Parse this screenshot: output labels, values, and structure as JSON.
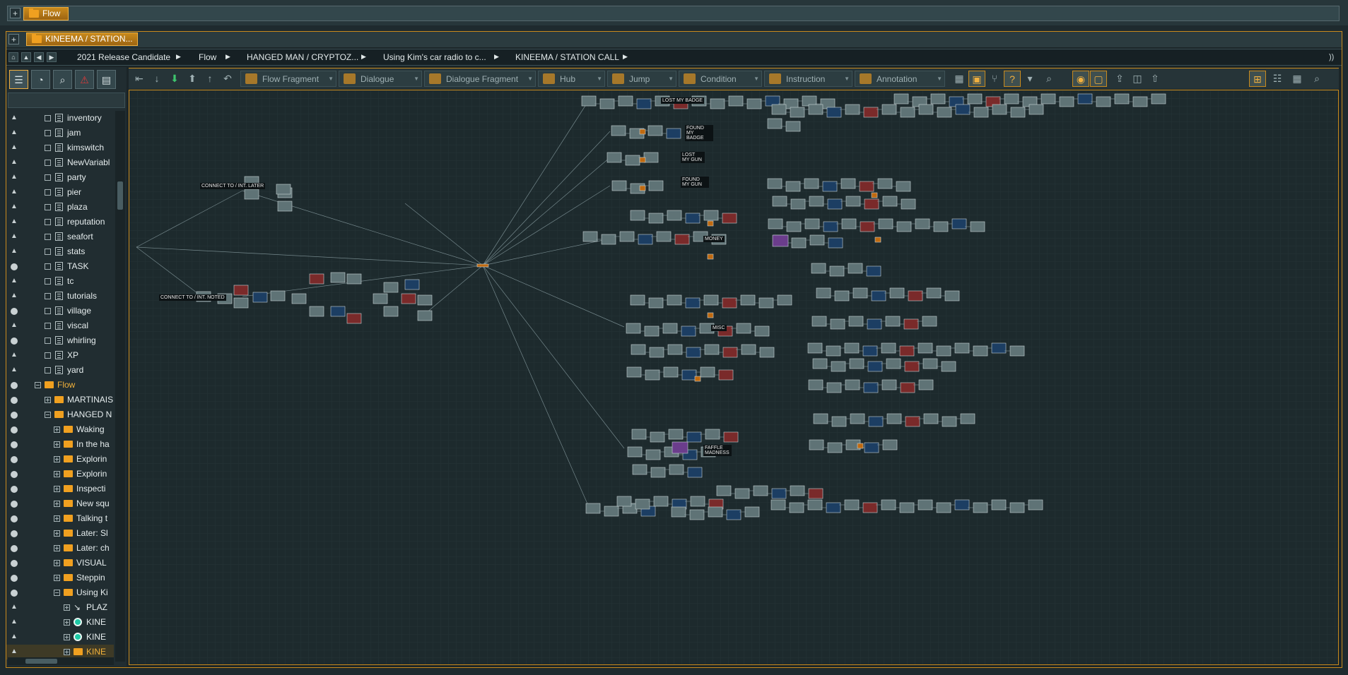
{
  "window": {
    "top_tab_label": "Flow",
    "doc_tab_label": "KINEEMA / STATION..."
  },
  "breadcrumbs": [
    "2021 Release Candidate",
    "Flow",
    "HANGED MAN / CRYPTOZ...",
    "Using Kim's car radio to c...",
    "KINEEMA / STATION CALL"
  ],
  "toolbar": {
    "buttons": [
      "Flow Fragment",
      "Dialogue",
      "Dialogue Fragment",
      "Hub",
      "Jump",
      "Condition",
      "Instruction",
      "Annotation"
    ]
  },
  "tree": {
    "variables": [
      "inventory",
      "jam",
      "kimswitch",
      "NewVariabl",
      "party",
      "pier",
      "plaza",
      "reputation",
      "seafort",
      "stats",
      "TASK",
      "tc",
      "tutorials",
      "village",
      "viscal",
      "whirling",
      "XP",
      "yard"
    ],
    "flow_label": "Flow",
    "flow_children": [
      "MARTINAIS",
      "HANGED N"
    ],
    "hanged_children": [
      "Waking",
      "In the ha",
      "Explorin",
      "Explorin",
      "Inspecti",
      "New squ",
      "Talking t",
      "Later: Sl",
      "Later: ch",
      "VISUAL",
      "Steppin",
      "Using Ki"
    ],
    "using_children": [
      "PLAZ",
      "KINE",
      "KINE",
      "KINE"
    ]
  },
  "canvas": {
    "labels": [
      "CONNECT TO / INT. LATER",
      "CONNECT TO / INT. NOTED",
      "LOST MY BADGE",
      "FOUND MY BADGE",
      "LOST MY GUN",
      "FOUND MY GUN",
      "MONEY",
      "MISC",
      "FAFFLE MADNESS"
    ]
  },
  "colors": {
    "accent": "#c98a1c",
    "node": "#5f7376",
    "node_red": "#7a2a2a",
    "node_blue": "#1c3e63",
    "node_purple": "#6b3d8c",
    "jump": "#c06a10",
    "link": "#8a9fa3"
  }
}
